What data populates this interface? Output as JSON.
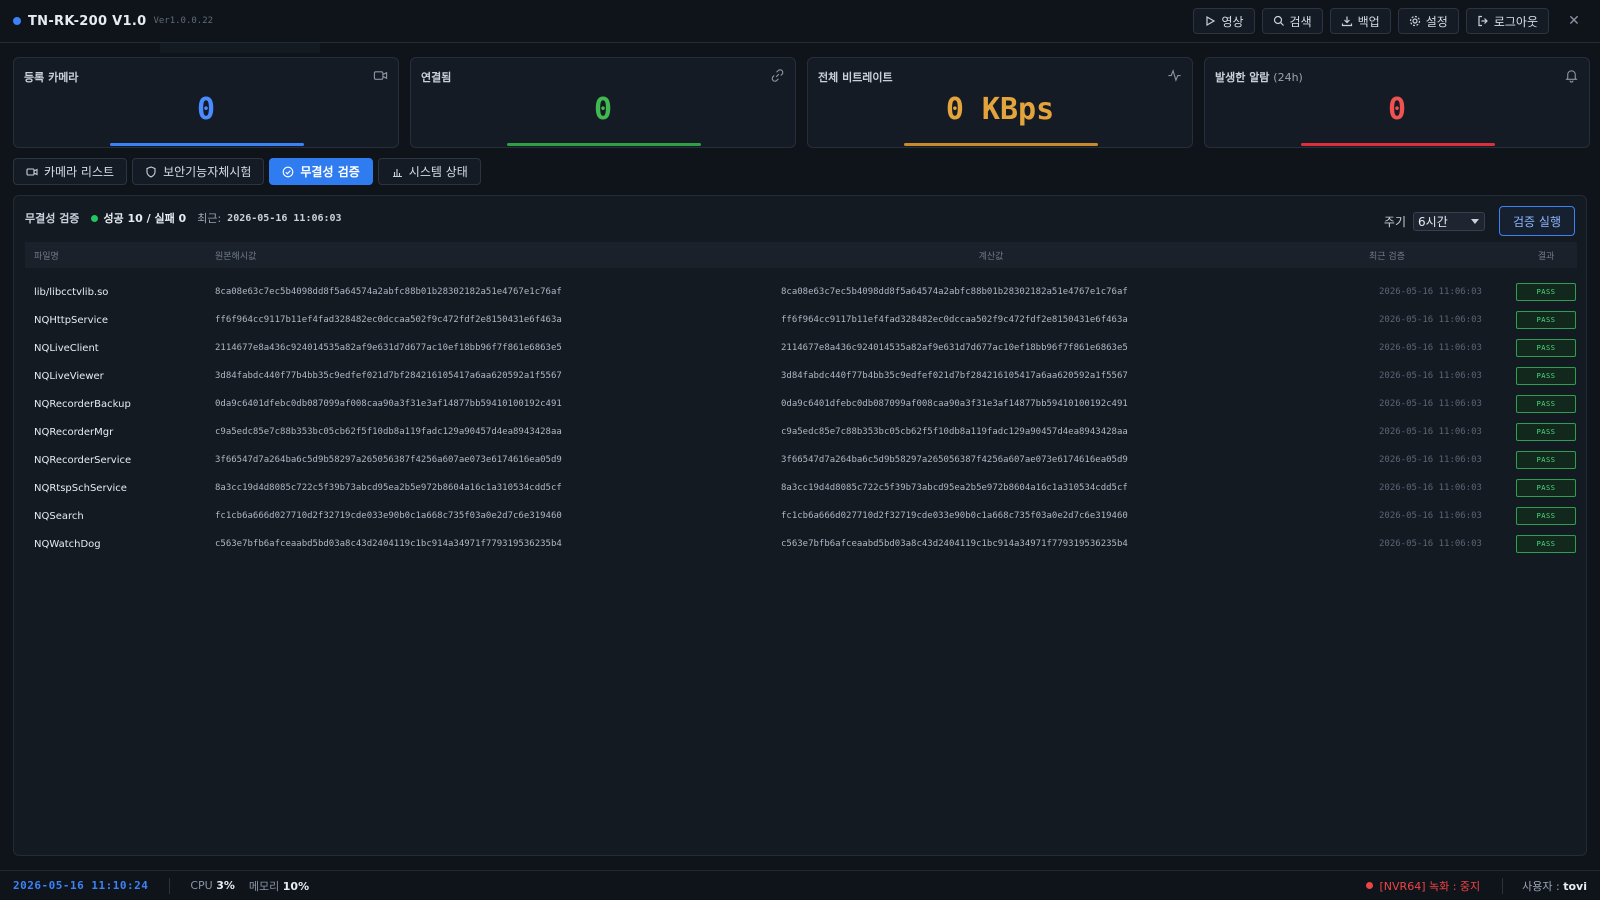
{
  "app": {
    "title": "TN-RK-200 V1.0",
    "version": "Ver1.0.0.22",
    "close": "✕"
  },
  "toolbar": {
    "video": "영상",
    "search": "검색",
    "backup": "백업",
    "settings": "설정",
    "logout": "로그아웃"
  },
  "stats": [
    {
      "label": "등록 카메라",
      "sub": "",
      "value": "0",
      "color": "#4a8cff",
      "bar": "#3b82f6",
      "icon": "video-camera-icon"
    },
    {
      "label": "연결됨",
      "sub": "",
      "value": "0",
      "color": "#3fb950",
      "bar": "#2ea043",
      "icon": "link-icon"
    },
    {
      "label": "전체 비트레이트",
      "sub": "",
      "value": "0 KBps",
      "color": "#e3a53b",
      "bar": "#c98a2b",
      "icon": "activity-icon"
    },
    {
      "label": "발생한 알람",
      "sub": "(24h)",
      "value": "0",
      "color": "#f05252",
      "bar": "#dc2f3a",
      "icon": "bell-icon"
    }
  ],
  "tabs": [
    {
      "label": "카메라 리스트",
      "icon": "video-camera-icon",
      "active": false
    },
    {
      "label": "보안기능자체시험",
      "icon": "shield-icon",
      "active": false
    },
    {
      "label": "무결성 검증",
      "icon": "check-circle-icon",
      "active": true
    },
    {
      "label": "시스템 상태",
      "icon": "bar-chart-icon",
      "active": false
    }
  ],
  "panel": {
    "title": "무결성 검증",
    "summary": "성공 10 / 실패 0",
    "recent_label": "최근:",
    "recent_time": "2026-05-16 11:06:03",
    "period_label": "주기",
    "period_value": "6시간",
    "run_button": "검증 실행"
  },
  "table": {
    "headers": {
      "file": "파일명",
      "original": "원본해시값",
      "calculated": "계산값",
      "last_check": "최근 검증",
      "result": "결과"
    },
    "rows": [
      {
        "file": "lib/libcctvlib.so",
        "original": "8ca08e63c7ec5b4098dd8f5a64574a2abfc88b01b28302182a51e4767e1c76af",
        "calculated": "8ca08e63c7ec5b4098dd8f5a64574a2abfc88b01b28302182a51e4767e1c76af",
        "time": "2026-05-16 11:06:03",
        "result": "PASS"
      },
      {
        "file": "NQHttpService",
        "original": "ff6f964cc9117b11ef4fad328482ec0dccaa502f9c472fdf2e8150431e6f463a",
        "calculated": "ff6f964cc9117b11ef4fad328482ec0dccaa502f9c472fdf2e8150431e6f463a",
        "time": "2026-05-16 11:06:03",
        "result": "PASS"
      },
      {
        "file": "NQLiveClient",
        "original": "2114677e8a436c924014535a82af9e631d7d677ac10ef18bb96f7f861e6863e5",
        "calculated": "2114677e8a436c924014535a82af9e631d7d677ac10ef18bb96f7f861e6863e5",
        "time": "2026-05-16 11:06:03",
        "result": "PASS"
      },
      {
        "file": "NQLiveViewer",
        "original": "3d84fabdc440f77b4bb35c9edfef021d7bf284216105417a6aa620592a1f5567",
        "calculated": "3d84fabdc440f77b4bb35c9edfef021d7bf284216105417a6aa620592a1f5567",
        "time": "2026-05-16 11:06:03",
        "result": "PASS"
      },
      {
        "file": "NQRecorderBackup",
        "original": "0da9c6401dfebc0db087099af008caa90a3f31e3af14877bb59410100192c491",
        "calculated": "0da9c6401dfebc0db087099af008caa90a3f31e3af14877bb59410100192c491",
        "time": "2026-05-16 11:06:03",
        "result": "PASS"
      },
      {
        "file": "NQRecorderMgr",
        "original": "c9a5edc85e7c88b353bc05cb62f5f10db8a119fadc129a90457d4ea8943428aa",
        "calculated": "c9a5edc85e7c88b353bc05cb62f5f10db8a119fadc129a90457d4ea8943428aa",
        "time": "2026-05-16 11:06:03",
        "result": "PASS"
      },
      {
        "file": "NQRecorderService",
        "original": "3f66547d7a264ba6c5d9b58297a265056387f4256a607ae073e6174616ea05d9",
        "calculated": "3f66547d7a264ba6c5d9b58297a265056387f4256a607ae073e6174616ea05d9",
        "time": "2026-05-16 11:06:03",
        "result": "PASS"
      },
      {
        "file": "NQRtspSchService",
        "original": "8a3cc19d4d8085c722c5f39b73abcd95ea2b5e972b8604a16c1a310534cdd5cf",
        "calculated": "8a3cc19d4d8085c722c5f39b73abcd95ea2b5e972b8604a16c1a310534cdd5cf",
        "time": "2026-05-16 11:06:03",
        "result": "PASS"
      },
      {
        "file": "NQSearch",
        "original": "fc1cb6a666d027710d2f32719cde033e90b0c1a668c735f03a0e2d7c6e319460",
        "calculated": "fc1cb6a666d027710d2f32719cde033e90b0c1a668c735f03a0e2d7c6e319460",
        "time": "2026-05-16 11:06:03",
        "result": "PASS"
      },
      {
        "file": "NQWatchDog",
        "original": "c563e7bfb6afceaabd5bd03a8c43d2404119c1bc914a34971f779319536235b4",
        "calculated": "c563e7bfb6afceaabd5bd03a8c43d2404119c1bc914a34971f779319536235b4",
        "time": "2026-05-16 11:06:03",
        "result": "PASS"
      }
    ]
  },
  "status": {
    "clock": "2026-05-16 11:10:24",
    "cpu_label": "CPU",
    "cpu_value": "3%",
    "mem_label": "메모리",
    "mem_value": "10%",
    "recording": "[NVR64] 녹화 : 중지",
    "user_label": "사용자 :",
    "user_name": "tovi"
  },
  "colors": {
    "accent": "#2f7bf0",
    "pass": "#4ade80",
    "alert": "#ef4444"
  }
}
